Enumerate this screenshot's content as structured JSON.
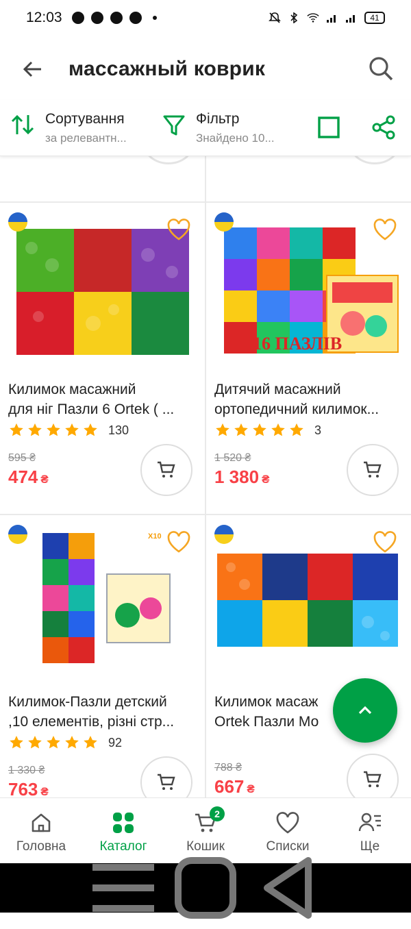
{
  "status_bar": {
    "time": "12:03",
    "battery": "41"
  },
  "header": {
    "search_query": "массажный коврик"
  },
  "toolbar": {
    "sort_label": "Сортування",
    "sort_value": "за релевантн...",
    "filter_label": "Фільтр",
    "filter_value": "Знайдено 10..."
  },
  "products": [
    {
      "name_line1": "Килимок масажний",
      "name_line2": "для ніг Пазли 6 Ortek ( ...",
      "reviews": "130",
      "old_price": "595 ₴",
      "price": "474",
      "currency": "₴",
      "rating": 5
    },
    {
      "name_line1": "Дитячий масажний",
      "name_line2": "ортопедичний килимок...",
      "reviews": "3",
      "old_price": "1 520 ₴",
      "price": "1 380",
      "currency": "₴",
      "rating": 5,
      "image_text": "16 ПАЗЛІВ"
    },
    {
      "name_line1": "Килимок-Пазли детский",
      "name_line2": ",10 елементів, різні стр...",
      "reviews": "92",
      "old_price": "1 330 ₴",
      "price": "763",
      "currency": "₴",
      "rating": 5,
      "image_text": "X10"
    },
    {
      "name_line1": "Килимок масаж",
      "name_line2": "Ortek Пазли Мо",
      "old_price": "788 ₴",
      "price": "667",
      "currency": "₴"
    }
  ],
  "colors": [
    "#f2c200",
    "#111111",
    "#5b21b6",
    "#f59e0b"
  ],
  "bottom_nav": [
    {
      "label": "Головна",
      "icon": "home-icon"
    },
    {
      "label": "Каталог",
      "icon": "catalog-icon",
      "active": true
    },
    {
      "label": "Кошик",
      "icon": "cart-icon",
      "badge": "2"
    },
    {
      "label": "Списки",
      "icon": "heart-icon"
    },
    {
      "label": "Ще",
      "icon": "more-icon"
    }
  ],
  "accent_color": "#00a046",
  "price_color": "#f84147"
}
